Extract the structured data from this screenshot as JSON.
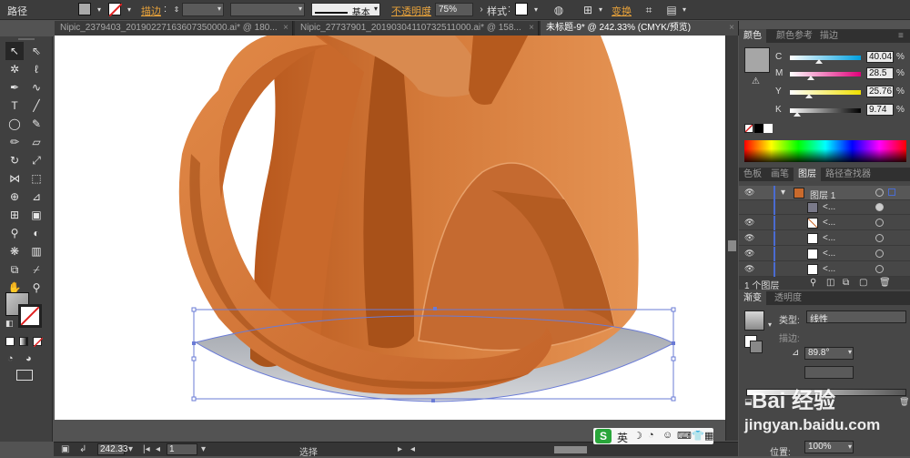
{
  "control_bar": {
    "object_type": "路径",
    "stroke_label": "描边",
    "stroke_weight": "",
    "profile_value": "",
    "brush_value": "基本",
    "opacity_label": "不透明度",
    "opacity_value": "75%",
    "style_label": "样式",
    "transform_label": "变换"
  },
  "tabs": [
    {
      "label": "Nipic_2379403_20190227163607350000.ai* @ 180..."
    },
    {
      "label": "Nipic_27737901_20190304110732511000.ai* @ 158..."
    },
    {
      "label": "未标题-9* @ 242.33% (CMYK/预览)"
    }
  ],
  "tools": [
    "select-tool",
    "direct-select-tool",
    "magic-wand-tool",
    "lasso-tool",
    "pen-tool",
    "curvature-tool",
    "type-tool",
    "line-tool",
    "ellipse-tool",
    "paintbrush-tool",
    "pencil-tool",
    "eraser-tool",
    "rotate-tool",
    "scale-tool",
    "width-tool",
    "free-transform-tool",
    "shape-builder-tool",
    "perspective-tool",
    "mesh-tool",
    "gradient-tool",
    "eyedropper-tool",
    "blend-tool",
    "symbol-sprayer-tool",
    "column-graph-tool",
    "artboard-tool",
    "slice-tool",
    "hand-tool",
    "zoom-tool"
  ],
  "status_bar": {
    "zoom": "242.33",
    "page": "1",
    "mode": "选择"
  },
  "color_panel": {
    "tabs": [
      "颜色",
      "颜色参考",
      "描边"
    ],
    "channels": [
      {
        "key": "C",
        "value": "40.04",
        "pos": 0.4
      },
      {
        "key": "M",
        "value": "28.5",
        "pos": 0.285
      },
      {
        "key": "Y",
        "value": "25.76",
        "pos": 0.2576
      },
      {
        "key": "K",
        "value": "9.74",
        "pos": 0.0974
      }
    ],
    "percent": "%"
  },
  "layers_panel": {
    "tabs": [
      "色板",
      "画笔",
      "图层",
      "路径查找器"
    ],
    "layer_name": "图层 1",
    "sublayer_name": "<...",
    "count_label": "1 个图层"
  },
  "gradient_panel": {
    "tabs": [
      "渐变",
      "透明度"
    ],
    "type_label": "类型:",
    "type_value": "线性",
    "stroke_label": "描边:",
    "angle_value": "89.8°",
    "location_label": "位置:",
    "location_value": "100%"
  },
  "ime": {
    "lang": "英"
  },
  "watermark": {
    "line1": "Bai 经验",
    "line2": "jingyan.baidu.com"
  },
  "colors": {
    "vase_light": "#e58a4a",
    "vase_mid": "#c96a2c",
    "vase_dark": "#9c4a17",
    "shadow": "#b9bcc2",
    "selection": "#6a7bd6",
    "orange_label": "#e8a23a"
  }
}
